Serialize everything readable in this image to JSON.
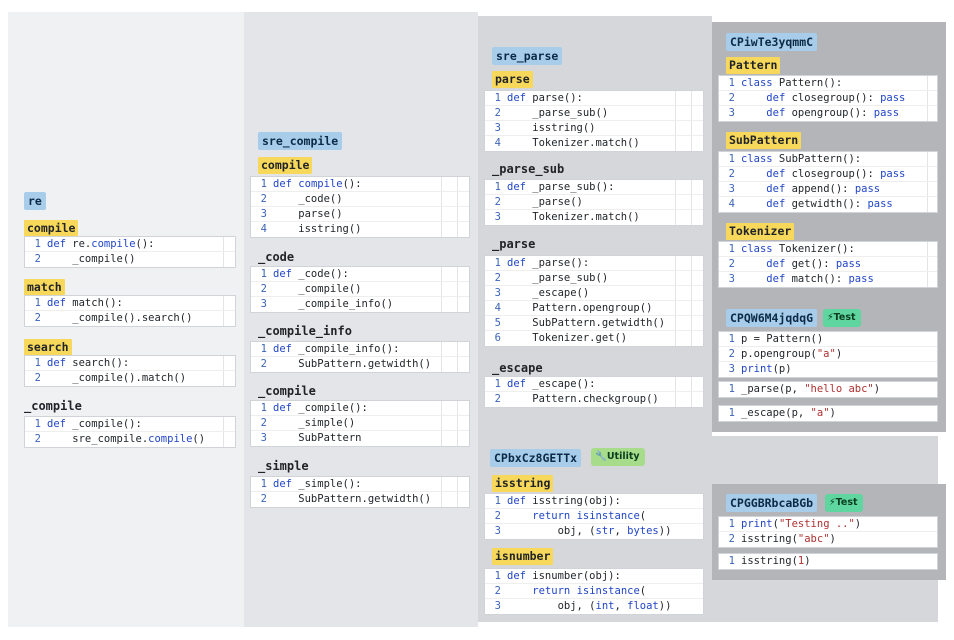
{
  "columns": {
    "re": {
      "title": "re",
      "functions": [
        {
          "name": "compile",
          "lines": [
            "def re.compile():",
            "    _compile()"
          ]
        },
        {
          "name": "match",
          "lines": [
            "def match():",
            "    _compile().search()"
          ]
        },
        {
          "name": "search",
          "lines": [
            "def search():",
            "    _compile().match()"
          ]
        },
        {
          "name": "_compile",
          "lines": [
            "def _compile():",
            "    sre_compile.compile()"
          ]
        }
      ]
    },
    "sre_compile": {
      "title": "sre_compile",
      "functions": [
        {
          "name": "compile",
          "lines": [
            "def compile():",
            "    _code()",
            "    parse()",
            "    isstring()"
          ]
        },
        {
          "name": "_code",
          "lines": [
            "def _code():",
            "    _compile()",
            "    _compile_info()"
          ]
        },
        {
          "name": "_compile_info",
          "lines": [
            "def _compile_info():",
            "    SubPattern.getwidth()"
          ]
        },
        {
          "name": "_compile",
          "lines": [
            "def _compile():",
            "    _simple()",
            "    SubPattern"
          ]
        },
        {
          "name": "_simple",
          "lines": [
            "def _simple():",
            "    SubPattern.getwidth()"
          ]
        }
      ]
    },
    "sre_parse": {
      "title": "sre_parse",
      "functions": [
        {
          "name": "parse",
          "lines": [
            "def parse():",
            "    _parse_sub()",
            "    isstring()",
            "    Tokenizer.match()"
          ]
        },
        {
          "name": "_parse_sub",
          "lines": [
            "def _parse_sub():",
            "    _parse()",
            "    Tokenizer.match()"
          ]
        },
        {
          "name": "_parse",
          "lines": [
            "def _parse():",
            "    _parse_sub()",
            "    _escape()",
            "    Pattern.opengroup()",
            "    SubPattern.getwidth()",
            "    Tokenizer.get()"
          ]
        },
        {
          "name": "_escape",
          "lines": [
            "def _escape():",
            "    Pattern.checkgroup()"
          ]
        }
      ]
    },
    "classes": {
      "title": "CPiwTe3yqmmC",
      "classes": [
        {
          "name": "Pattern",
          "lines": [
            "class Pattern():",
            "    def closegroup(): pass",
            "    def opengroup(): pass"
          ]
        },
        {
          "name": "SubPattern",
          "lines": [
            "class SubPattern():",
            "    def closegroup(): pass",
            "    def append(): pass",
            "    def getwidth(): pass"
          ]
        },
        {
          "name": "Tokenizer",
          "lines": [
            "class Tokenizer():",
            "    def get(): pass",
            "    def match(): pass"
          ]
        }
      ]
    },
    "test1": {
      "title": "CPQW6M4jqdqG",
      "badge": "⚡Test",
      "blocks": [
        [
          "p = Pattern()",
          "p.opengroup(\"a\")",
          "print(p)"
        ],
        [
          "_parse(p, \"hello abc\")"
        ],
        [
          "_escape(p, \"a\")"
        ]
      ]
    },
    "utility": {
      "title": "CPbxCz8GETTx",
      "badge": "🔧Utility",
      "functions": [
        {
          "name": "isstring",
          "lines": [
            "def isstring(obj):",
            "    return isinstance(",
            "        obj, (str, bytes))"
          ]
        },
        {
          "name": "isnumber",
          "lines": [
            "def isnumber(obj):",
            "    return isinstance(",
            "        obj, (int, float))"
          ]
        }
      ]
    },
    "test2": {
      "title": "CPGGBRbcaBGb",
      "badge": "⚡Test",
      "blocks": [
        [
          "print(\"Testing ..\")",
          "isstring(\"abc\")"
        ],
        [
          "isstring(1)"
        ]
      ]
    }
  },
  "colors": {
    "module_tag": "#a8cdea",
    "function_tag": "#f7d85a",
    "test_badge": "#5fd6a0",
    "utility_badge": "#a6dc8a",
    "keyword": "#2145c8",
    "string": "#b03030"
  }
}
